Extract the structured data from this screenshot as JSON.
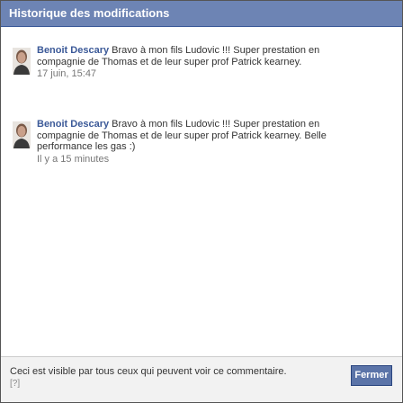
{
  "dialog": {
    "title": "Historique des modifications"
  },
  "entries": [
    {
      "author": "Benoit Descary",
      "text": " Bravo à mon fils Ludovic !!! Super prestation en compagnie de Thomas et de leur super prof Patrick kearney.",
      "time": "17 juin, 15:47"
    },
    {
      "author": "Benoit Descary",
      "text": " Bravo à mon fils Ludovic !!! Super prestation en compagnie de Thomas et de leur super prof Patrick kearney. Belle performance les gas :)",
      "time": "Il y a 15 minutes"
    }
  ],
  "footer": {
    "visibility_text": "Ceci est visible par tous ceux qui peuvent voir ce commentaire.",
    "help_link": "[?]",
    "close_label": "Fermer"
  },
  "colors": {
    "title_bar": "#6d84b4",
    "author_link": "#3b5998",
    "button": "#5b74a8"
  }
}
